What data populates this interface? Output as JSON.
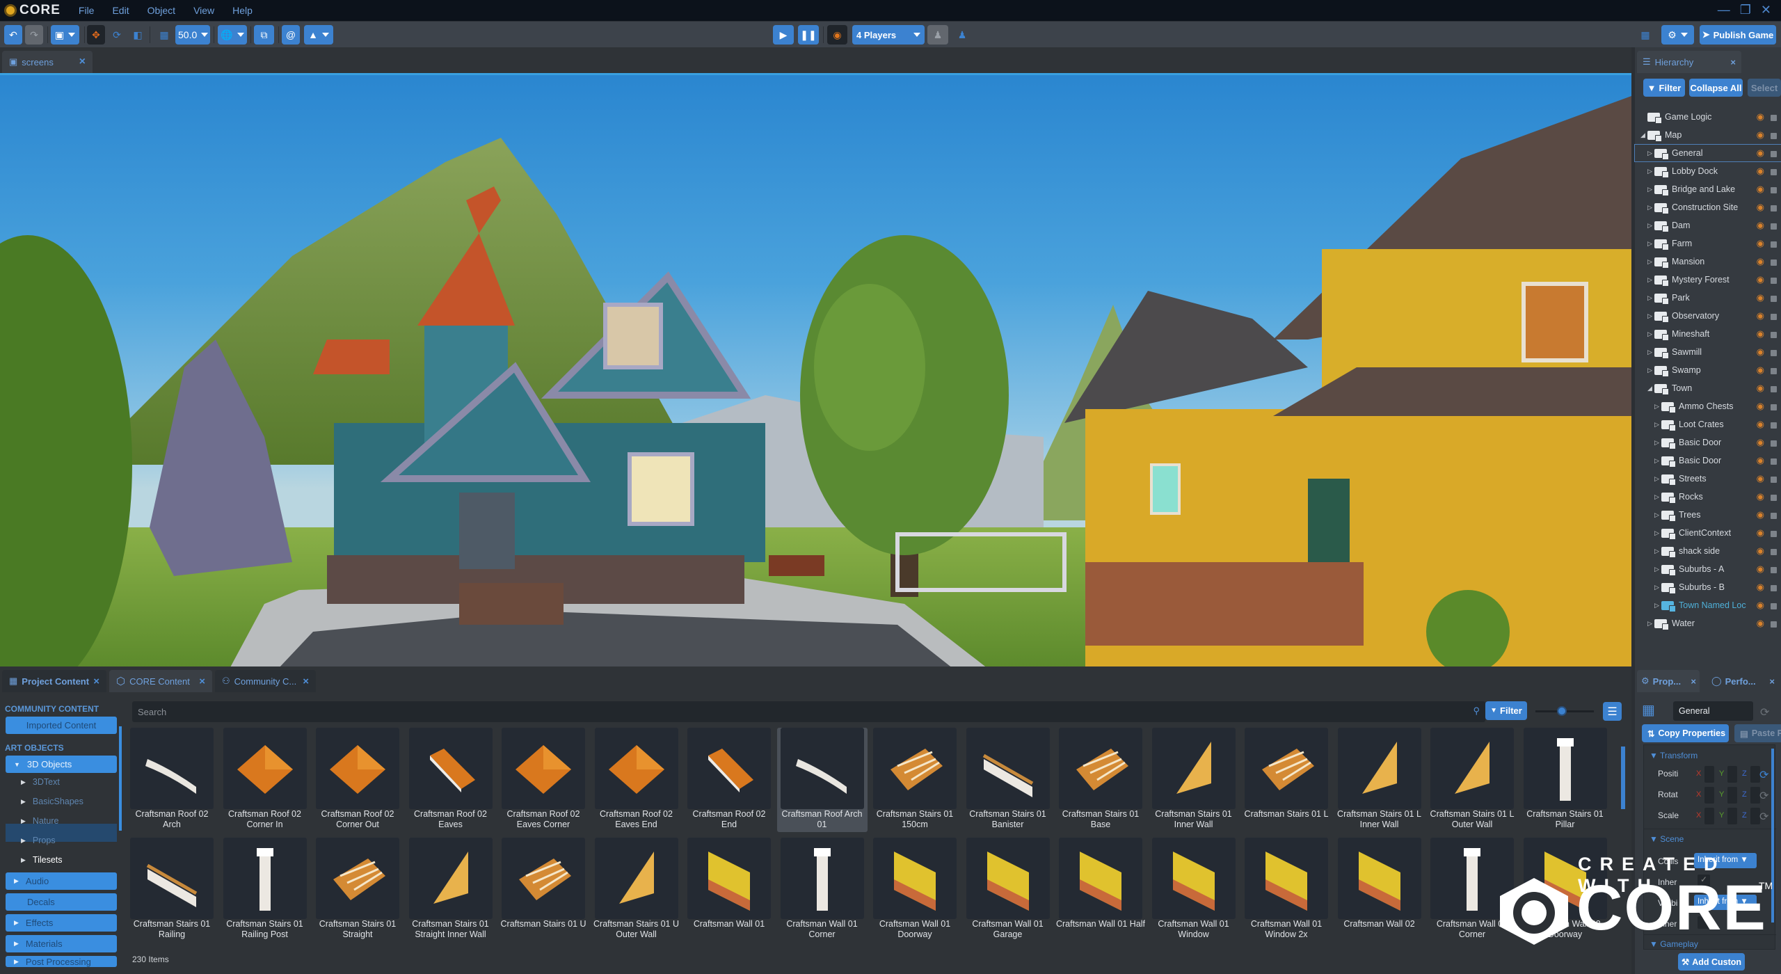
{
  "app": {
    "brand": "CORE"
  },
  "menu": [
    "File",
    "Edit",
    "Object",
    "View",
    "Help"
  ],
  "toolbar": {
    "grid_size": "50.0",
    "players": "4 Players",
    "publish_label": "Publish Game"
  },
  "viewport_tab": {
    "label": "screens"
  },
  "hierarchy": {
    "tab_label": "Hierarchy",
    "filter_label": "Filter",
    "collapse_label": "Collapse All",
    "select_label": "Select",
    "items": [
      {
        "label": "Game Logic",
        "depth": 0,
        "arrow": ""
      },
      {
        "label": "Map",
        "depth": 0,
        "arrow": "open"
      },
      {
        "label": "General",
        "depth": 1,
        "arrow": "closed",
        "selected": true
      },
      {
        "label": "Lobby Dock",
        "depth": 1,
        "arrow": "closed"
      },
      {
        "label": "Bridge and Lake",
        "depth": 1,
        "arrow": "closed"
      },
      {
        "label": "Construction Site",
        "depth": 1,
        "arrow": "closed"
      },
      {
        "label": "Dam",
        "depth": 1,
        "arrow": "closed"
      },
      {
        "label": "Farm",
        "depth": 1,
        "arrow": "closed"
      },
      {
        "label": "Mansion",
        "depth": 1,
        "arrow": "closed"
      },
      {
        "label": "Mystery Forest",
        "depth": 1,
        "arrow": "closed"
      },
      {
        "label": "Park",
        "depth": 1,
        "arrow": "closed"
      },
      {
        "label": "Observatory",
        "depth": 1,
        "arrow": "closed"
      },
      {
        "label": "Mineshaft",
        "depth": 1,
        "arrow": "closed"
      },
      {
        "label": "Sawmill",
        "depth": 1,
        "arrow": "closed"
      },
      {
        "label": "Swamp",
        "depth": 1,
        "arrow": "closed"
      },
      {
        "label": "Town",
        "depth": 1,
        "arrow": "open"
      },
      {
        "label": "Ammo Chests",
        "depth": 2,
        "arrow": "closed"
      },
      {
        "label": "Loot Crates",
        "depth": 2,
        "arrow": "closed"
      },
      {
        "label": "Basic Door",
        "depth": 2,
        "arrow": "closed"
      },
      {
        "label": "Basic Door",
        "depth": 2,
        "arrow": "closed"
      },
      {
        "label": "Streets",
        "depth": 2,
        "arrow": "closed"
      },
      {
        "label": "Rocks",
        "depth": 2,
        "arrow": "closed"
      },
      {
        "label": "Trees",
        "depth": 2,
        "arrow": "closed"
      },
      {
        "label": "ClientContext",
        "depth": 2,
        "arrow": "closed"
      },
      {
        "label": "shack side",
        "depth": 2,
        "arrow": "closed"
      },
      {
        "label": "Suburbs - A",
        "depth": 2,
        "arrow": "closed"
      },
      {
        "label": "Suburbs - B",
        "depth": 2,
        "arrow": "closed"
      },
      {
        "label": "Town Named Loc",
        "depth": 2,
        "arrow": "closed",
        "highlight": true
      },
      {
        "label": "Water",
        "depth": 1,
        "arrow": "closed"
      }
    ]
  },
  "bottom_tabs": [
    "Project Content",
    "CORE Content",
    "Community C..."
  ],
  "categories": {
    "community_header": "COMMUNITY CONTENT",
    "imported": "Imported Content",
    "art_header": "ART OBJECTS",
    "objects": "3D Objects",
    "subs": [
      "3DText",
      "BasicShapes",
      "Nature",
      "Props",
      "Tilesets"
    ],
    "others": [
      "Audio",
      "Decals",
      "Effects",
      "Materials",
      "Post Processing"
    ]
  },
  "browser": {
    "search_placeholder": "Search",
    "filter_label": "Filter",
    "zoom_level": 0.45,
    "items_count": "230 Items",
    "items": [
      {
        "label": "Craftsman Roof 02 Arch",
        "thumb": "arch"
      },
      {
        "label": "Craftsman Roof 02 Corner In",
        "thumb": "roof"
      },
      {
        "label": "Craftsman Roof 02 Corner Out",
        "thumb": "roof"
      },
      {
        "label": "Craftsman Roof 02 Eaves",
        "thumb": "eave"
      },
      {
        "label": "Craftsman Roof 02 Eaves Corner",
        "thumb": "roof"
      },
      {
        "label": "Craftsman Roof 02 Eaves End",
        "thumb": "roof"
      },
      {
        "label": "Craftsman Roof 02 End",
        "thumb": "eave"
      },
      {
        "label": "Craftsman Roof Arch 01",
        "thumb": "arch",
        "selected": true
      },
      {
        "label": "Craftsman Stairs 01 150cm",
        "thumb": "stairs"
      },
      {
        "label": "Craftsman Stairs 01 Banister",
        "thumb": "rail"
      },
      {
        "label": "Craftsman Stairs 01 Base",
        "thumb": "stairs"
      },
      {
        "label": "Craftsman Stairs 01 Inner Wall",
        "thumb": "tri"
      },
      {
        "label": "Craftsman Stairs 01 L",
        "thumb": "stairs"
      },
      {
        "label": "Craftsman Stairs 01 L Inner Wall",
        "thumb": "tri"
      },
      {
        "label": "Craftsman Stairs 01 L Outer Wall",
        "thumb": "tri"
      },
      {
        "label": "Craftsman Stairs 01 Pillar",
        "thumb": "post"
      },
      {
        "label": "Craftsman Stairs 01 Railing",
        "thumb": "rail"
      },
      {
        "label": "Craftsman Stairs 01 Railing Post",
        "thumb": "post"
      },
      {
        "label": "Craftsman Stairs 01 Straight",
        "thumb": "stairs"
      },
      {
        "label": "Craftsman Stairs 01 Straight Inner Wall",
        "thumb": "tri"
      },
      {
        "label": "Craftsman Stairs 01 U",
        "thumb": "stairs"
      },
      {
        "label": "Craftsman Stairs 01 U Outer Wall",
        "thumb": "tri"
      },
      {
        "label": "Craftsman Wall 01",
        "thumb": "wall"
      },
      {
        "label": "Craftsman Wall 01 Corner",
        "thumb": "post"
      },
      {
        "label": "Craftsman Wall 01 Doorway",
        "thumb": "wall"
      },
      {
        "label": "Craftsman Wall 01 Garage",
        "thumb": "wall"
      },
      {
        "label": "Craftsman Wall 01 Half",
        "thumb": "wall"
      },
      {
        "label": "Craftsman Wall 01 Window",
        "thumb": "wall"
      },
      {
        "label": "Craftsman Wall 01 Window 2x",
        "thumb": "wall"
      },
      {
        "label": "Craftsman Wall 02",
        "thumb": "wall"
      },
      {
        "label": "Craftsman Wall 02 Corner",
        "thumb": "post"
      },
      {
        "label": "Craftsman Wall 02 Doorway",
        "thumb": "wall"
      }
    ]
  },
  "properties": {
    "tab_label": "Prop...",
    "perf_tab_label": "Perfo...",
    "name_value": "General",
    "copy_label": "Copy Properties",
    "paste_label": "Paste P",
    "transform_header": "Transform",
    "rows": [
      "Positi",
      "Rotat",
      "Scale"
    ],
    "axes": [
      "X",
      "Y",
      "Z"
    ],
    "scene_header": "Scene",
    "scene_rows": [
      "Collis",
      "Inher",
      "Visibi",
      "Inher"
    ],
    "inherit_label": "Inherit from",
    "gameplay_header": "Gameplay",
    "add_custom_label": "Add Custon"
  },
  "watermark": {
    "top": "CREATED WITH",
    "brand": "CORE",
    "tm": "TM"
  },
  "colors": {
    "accent": "#3c82d0",
    "eye": "#d9822b",
    "highlight": "#4fb0d8"
  }
}
